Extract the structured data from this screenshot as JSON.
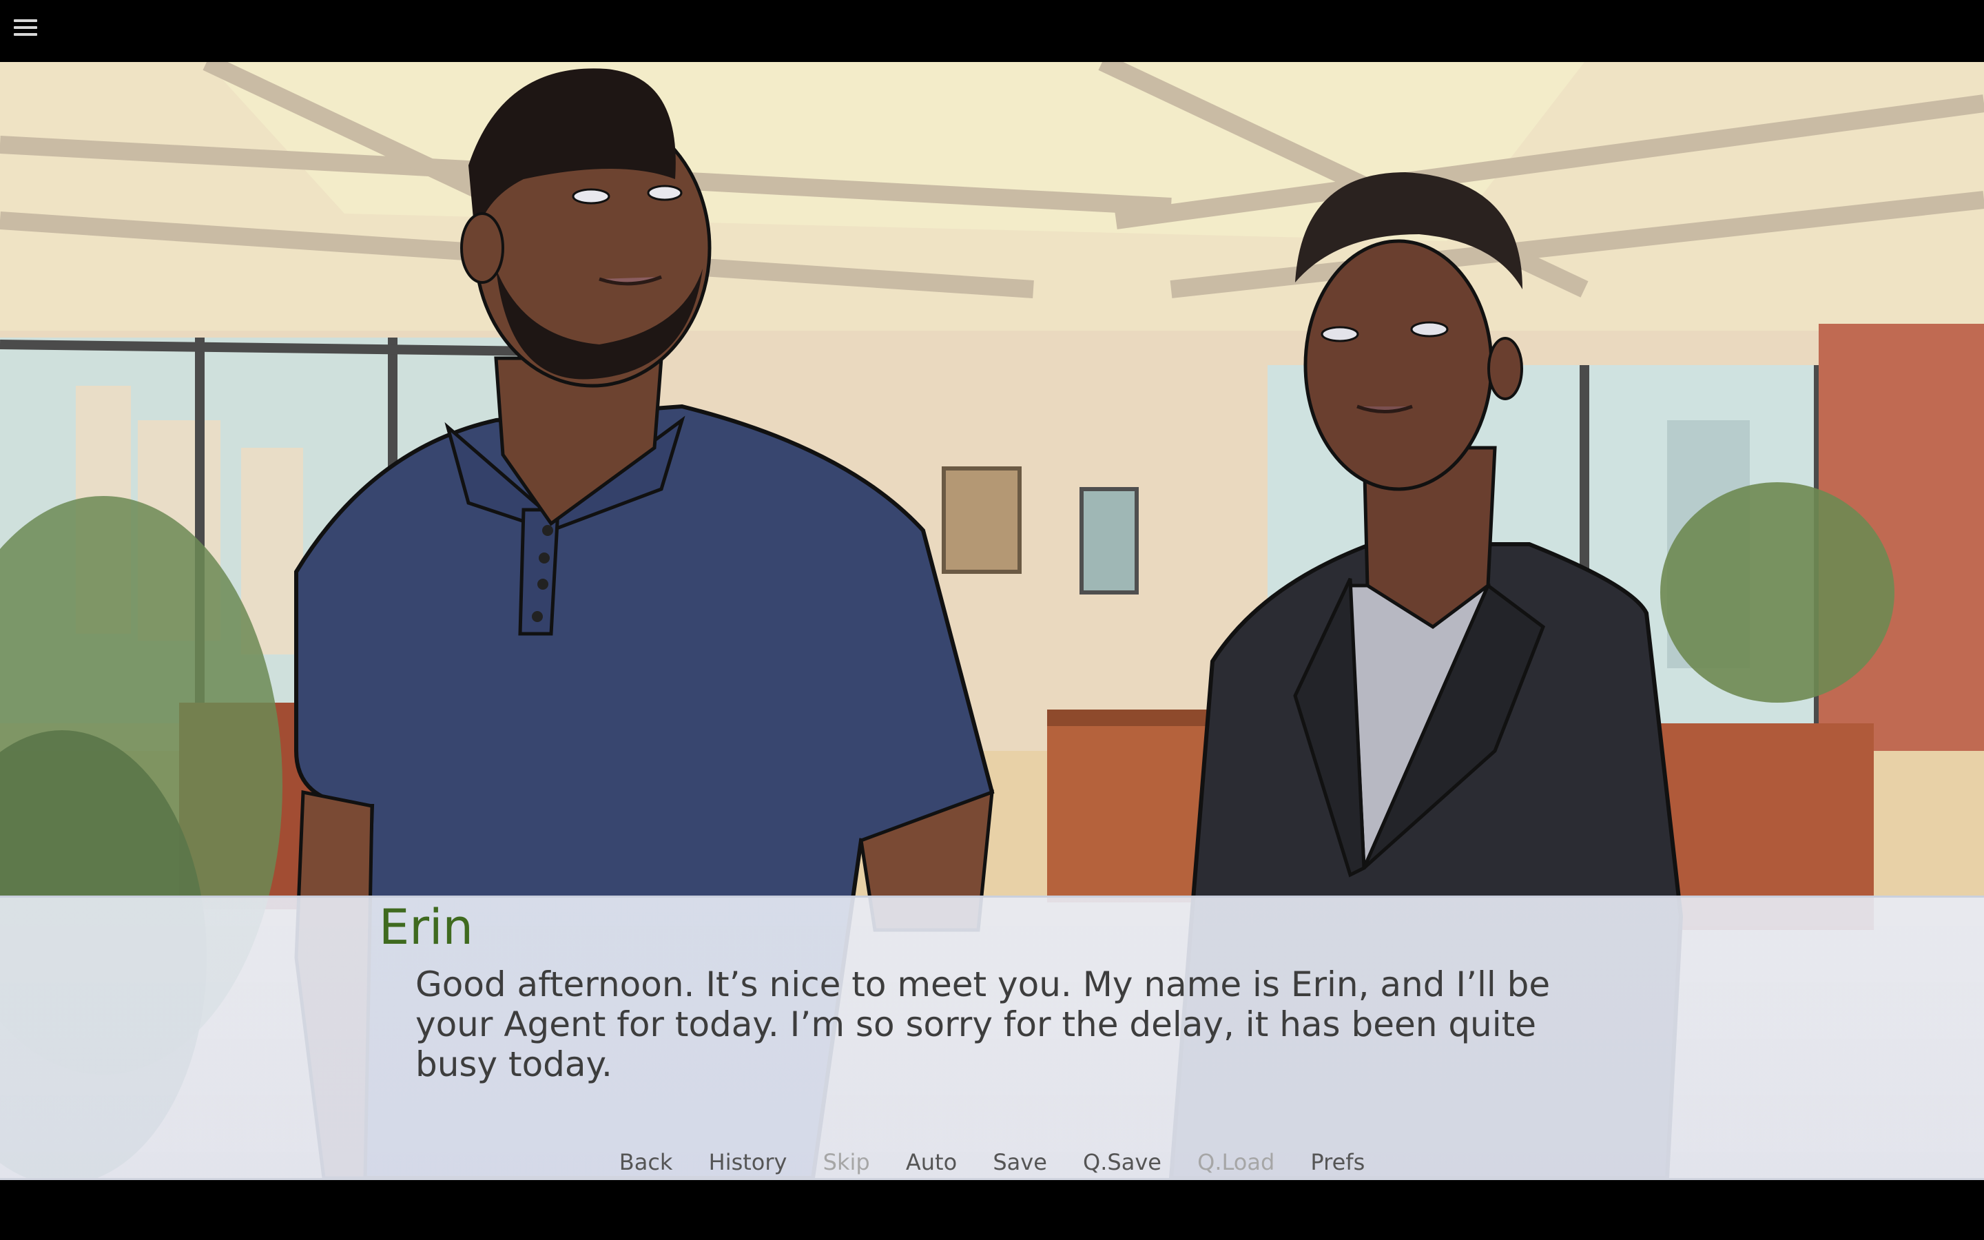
{
  "menu": {
    "icon": "hamburger-menu-icon"
  },
  "dialogue": {
    "speaker": "Erin",
    "speaker_color": "#3f6a1f",
    "text": "Good afternoon. It’s nice to meet you. My name is Erin, and I’ll be your Agent for today. I’m so sorry for the delay, it has been quite busy today."
  },
  "quick_menu": {
    "back": "Back",
    "history": "History",
    "skip": "Skip",
    "auto": "Auto",
    "save": "Save",
    "qsave": "Q.Save",
    "qload": "Q.Load",
    "prefs": "Prefs"
  }
}
